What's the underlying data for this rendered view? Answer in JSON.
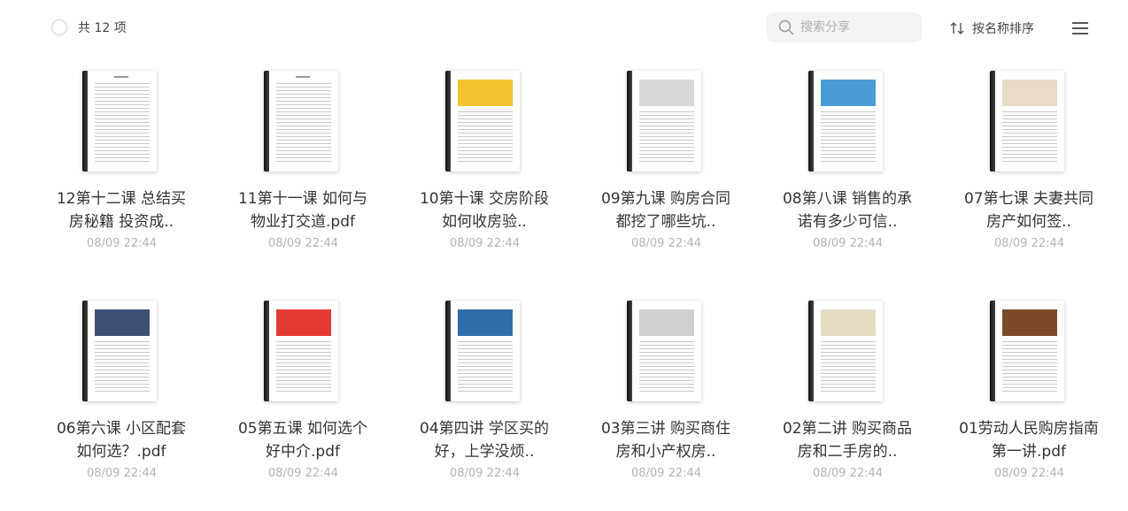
{
  "header": {
    "count_label": "共 12 项",
    "search_placeholder": "搜索分享",
    "sort_label": "按名称排序"
  },
  "files": [
    {
      "title": "12第十二课 总结买房秘籍 投资成..",
      "date": "08/09 22:44",
      "thumb": "text",
      "color": ""
    },
    {
      "title": "11第十一课 如何与物业打交道.pdf",
      "date": "08/09 22:44",
      "thumb": "text",
      "color": ""
    },
    {
      "title": "10第十课 交房阶段如何收房验..",
      "date": "08/09 22:44",
      "thumb": "image",
      "color": "#f2c230"
    },
    {
      "title": "09第九课 购房合同都挖了哪些坑..",
      "date": "08/09 22:44",
      "thumb": "image",
      "color": "#d8d8d8"
    },
    {
      "title": "08第八课 销售的承诺有多少可信..",
      "date": "08/09 22:44",
      "thumb": "image",
      "color": "#4a9ad4"
    },
    {
      "title": "07第七课 夫妻共同房产如何签..",
      "date": "08/09 22:44",
      "thumb": "image",
      "color": "#e8dcc6"
    },
    {
      "title": "06第六课 小区配套如何选？.pdf",
      "date": "08/09 22:44",
      "thumb": "image",
      "color": "#3d4f72"
    },
    {
      "title": "05第五课 如何选个好中介.pdf",
      "date": "08/09 22:44",
      "thumb": "image",
      "color": "#e53935"
    },
    {
      "title": "04第四讲 学区买的好，上学没烦..",
      "date": "08/09 22:44",
      "thumb": "image",
      "color": "#2e6ea8"
    },
    {
      "title": "03第三讲 购买商住房和小产权房..",
      "date": "08/09 22:44",
      "thumb": "image",
      "color": "#cfcfcf"
    },
    {
      "title": "02第二讲 购买商品房和二手房的..",
      "date": "08/09 22:44",
      "thumb": "image",
      "color": "#e6dcc4"
    },
    {
      "title": "01劳动人民购房指南 第一讲.pdf",
      "date": "08/09 22:44",
      "thumb": "image",
      "color": "#7a4a2a"
    }
  ]
}
